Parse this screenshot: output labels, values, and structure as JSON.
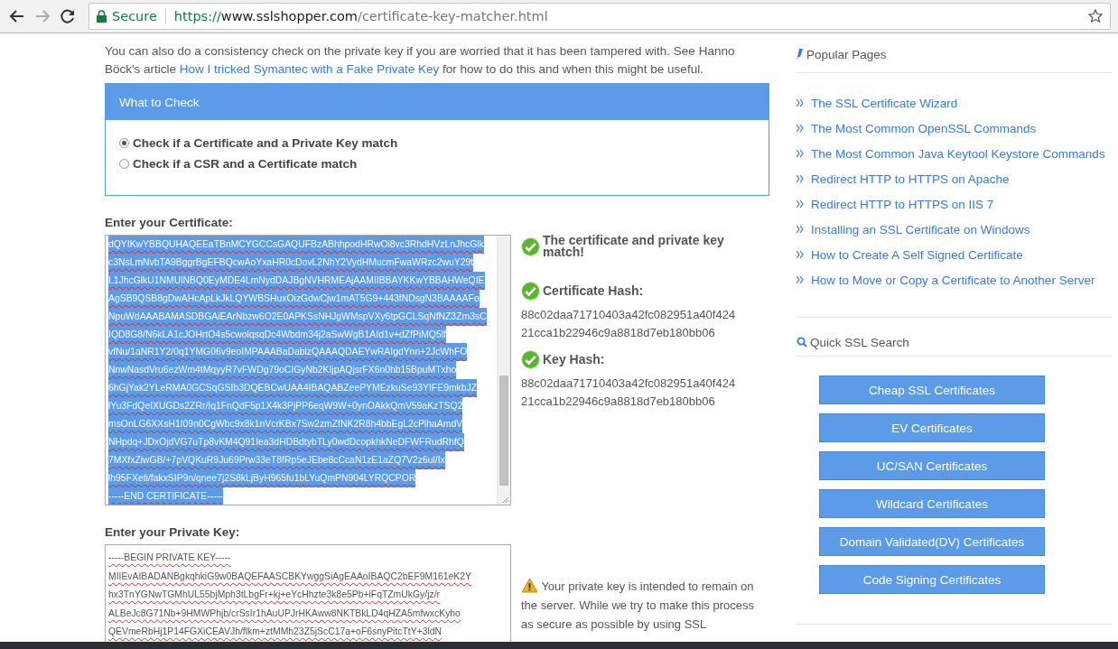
{
  "browser": {
    "secure_label": "Secure",
    "url_scheme": "https://",
    "url_host": "www.sslshopper.com",
    "url_path": "/certificate-key-matcher.html"
  },
  "intro": {
    "before": "You can also do a consistency check on the private key if you are worried that it has been tampered with. See Hanno Böck's article ",
    "link": "How I tricked Symantec with a Fake Private Key",
    "after": " for how to do this and when this might be useful."
  },
  "what_to_check": {
    "title": "What to Check",
    "options": [
      {
        "label": "Check if a Certificate and a Private Key match",
        "selected": true
      },
      {
        "label": "Check if a CSR and a Certificate match",
        "selected": false
      }
    ]
  },
  "certificate": {
    "label": "Enter your Certificate:",
    "selected": true,
    "lines": [
      "dQYIKwYBBQUHAQEEaTBnMCYGCCsGAQUFBzABhhpodHRwOi8vc3RhdHVzLnJhcGlk",
      "c3NsLmNvbTA9BggrBgEFBQcwAoYxaHR0cDovL2NhY2VydHMucmFwaWRzc2wuY29t",
      "L1JhcGlkU1NMUlNBQ0EyMDE4LmNydDAJBgNVHRMEAjAAMIIBBAYKKwYBBAHWeQIE",
      "AgSB9QSB8gDwAHcApLkJkLQYWBSHuxOizGdwCjw1mAT5G9+443fNDsgN3BAAAAFo",
      "NpuWdAAABAMASDBGAiEArNbzw6O2E0APKSsNHJgWMspVXy6tpGCLSqNfNZ3Zm3sC",
      "IQD8G8/N6kLA1cJOHrtO4s5cwolqsqDc4Wbdm34j2aSwWgB1AId1v+dZfPiMQ5lf",
      "vfNu/1aNR1Y2/0q1YMG06v9eoIMPAAABaDablzQAAAQDAEYwRAIgdYnn+2JcWhFO",
      "NnwNasdVru6ezWm4tMqyyR7vFWDg79oCIGyNb2KIjpAQjsrFX6n0hb15BpuMTxho",
      "6hGjYak2YLeRMA0GCSqGSIb3DQEBCwUAA4IBAQABZeePYMEzkuSe93YIFE9mkbJZ",
      "lYu3FdQeIXUGDs2ZRr/Iq1FnQdF5p1X4k3PjPP6eqW9W+0ynOAkkQmV59aKzTSQ2",
      "msOnLG6XXsH1I09n0CgWbc9x8k1nVcrKBx7Sw2zmZfNK2R8h4bbEgL2cPlhaAmdV",
      "NHpdq+JDxOjdVG7uTp8vKM4Q91Iea3dHDBdtybTLy0wdDcopkhkNeDFWFRudRhfQ",
      "7MXfxZiwGB/+7pVQKuR9Ju69Prw33eT8fRp5eJEbe8cCcaN1zE1aZQ7V2z6ul/Ix",
      "lh95FXeti/fakxSIP9n/qnee7j2S8kLjByH965fu1bLYuQmPN904LYRQCPOR",
      "-----END CERTIFICATE-----"
    ]
  },
  "results": [
    {
      "kind": "message",
      "title": "The certificate and private key match!"
    },
    {
      "kind": "hash",
      "title": "Certificate Hash:",
      "lines": [
        "88c02daa71710403a42fc082951a40f424",
        "21cca1b22946c9a8818d7eb180bb06"
      ]
    },
    {
      "kind": "hash",
      "title": "Key Hash:",
      "lines": [
        "88c02daa71710403a42fc082951a40f424",
        "21cca1b22946c9a8818d7eb180bb06"
      ]
    }
  ],
  "private_key": {
    "label": "Enter your Private Key:",
    "selected": false,
    "lines": [
      "-----BEGIN PRIVATE KEY-----",
      "MIIEvAIBADANBgkqhkiG9w0BAQEFAASCBKYwggSiAgEAAoIBAQC2bEF9M161eK2Y",
      "hx3TnYGNwTGMhUL55bjMph3tLbgFr+kj+eYcHhzte3k8e5Pb+iFqTZmUkGy/jz/r",
      "ALBeJc8G71Nb+9HMWPhjb/crSsIr1hAuUPJrHKAww8NKTBkLD4qHZA5mfwxcKyho",
      "QEVmeRbHj1P14FGXiCEAVJh/flkm+ztMMh23Z5jScC17a+oF6snyPitcTtY+3ldN"
    ]
  },
  "warning": "Your private key is intended to remain on the server. While we try to make this process as secure as possible by using SSL",
  "sidebar": {
    "popular_title": "Popular Pages",
    "links": [
      "The SSL Certificate Wizard",
      "The Most Common OpenSSL Commands",
      "The Most Common Java Keytool Keystore Commands",
      "Redirect HTTP to HTTPS on Apache",
      "Redirect HTTP to HTTPS on IIS 7",
      "Installing an SSL Certificate on Windows",
      "How to Create A Self Signed Certificate",
      "How to Move or Copy a Certificate to Another Server"
    ],
    "search_title": "Quick SSL Search",
    "buttons": [
      "Cheap SSL Certificates",
      "EV Certificates",
      "UC/SAN Certificates",
      "Wildcard Certificates",
      "Domain Validated(DV) Certificates",
      "Code Signing Certificates"
    ]
  }
}
